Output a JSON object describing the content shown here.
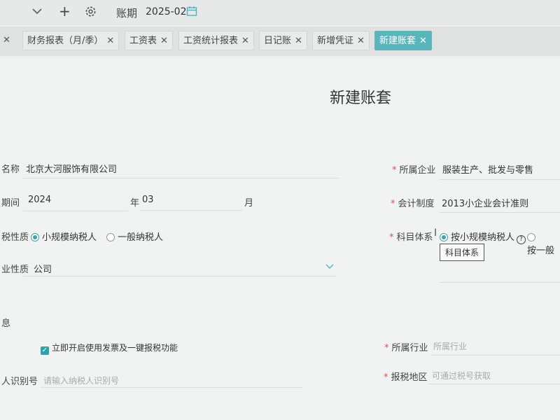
{
  "header": {
    "period_label": "账期",
    "period_value": "2025-02"
  },
  "tabs": [
    {
      "label": "财务报表（月/季）"
    },
    {
      "label": "工资表"
    },
    {
      "label": "工资统计报表"
    },
    {
      "label": "日记账"
    },
    {
      "label": "新增凭证"
    },
    {
      "label": "新建账套",
      "active": true
    }
  ],
  "form": {
    "title": "新建账套",
    "name_label": "名称",
    "name_value": "北京大河服饰有限公司",
    "period_label": "期间",
    "year_value": "2024",
    "year_unit": "年",
    "month_value": "03",
    "month_unit": "月",
    "tax_label": "税性质",
    "tax_opt1": "小规模纳税人",
    "tax_opt2": "一般纳税人",
    "biz_label": "业性质",
    "biz_value": "公司",
    "company_label": "所属企业",
    "company_value": "服装生产、批发与零售",
    "acct_label": "会计制度",
    "acct_value": "2013小企业会计准则",
    "subject_label": "科目体系",
    "subject_opt1": "按小规模纳税人",
    "subject_opt2": "按一般",
    "tooltip": "科目体系"
  },
  "info": {
    "section_label": "息",
    "invoice_label": "立即开启使用发票及一键报税功能",
    "taxid_label": "人识别号",
    "taxid_placeholder": "请输入纳税人识别号",
    "industry_label": "所属行业",
    "industry_placeholder": "所属行业",
    "region_label": "报税地区",
    "region_placeholder": "可通过税号获取"
  }
}
